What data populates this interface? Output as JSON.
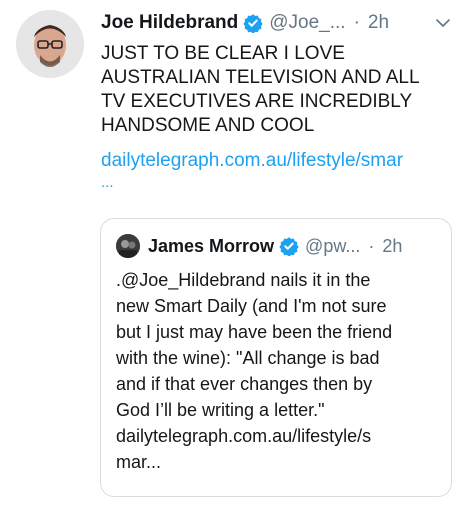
{
  "tweet": {
    "author_name": "Joe Hildebrand",
    "handle": "@Joe_...",
    "separator": "·",
    "time": "2h",
    "text": "JUST TO BE CLEAR I LOVE\nAUSTRALIAN TELEVISION AND ALL\nTV EXECUTIVES ARE INCREDIBLY\nHANDSOME AND COOL",
    "link": "dailytelegraph.com.au/lifestyle/smar",
    "link_ellipsis": "...",
    "icons": [
      "avatar",
      "verified-badge-icon",
      "chevron-down-icon"
    ]
  },
  "quoted": {
    "author_name": "James Morrow",
    "handle": "@pw...",
    "separator": "·",
    "time": "2h",
    "text": ".@Joe_Hildebrand nails it in the\nnew Smart Daily (and I'm not sure\nbut I just may have been the friend\nwith the wine): \"All change is bad\nand if that ever changes then by\nGod I’ll be writing a letter.\"\ndailytelegraph.com.au/lifestyle/s\nmar...",
    "icons": [
      "avatar",
      "verified-badge-icon"
    ]
  },
  "colors": {
    "verified": "#1da1f2",
    "link": "#1da1f2",
    "muted": "#657786",
    "border": "#d6dde3"
  }
}
